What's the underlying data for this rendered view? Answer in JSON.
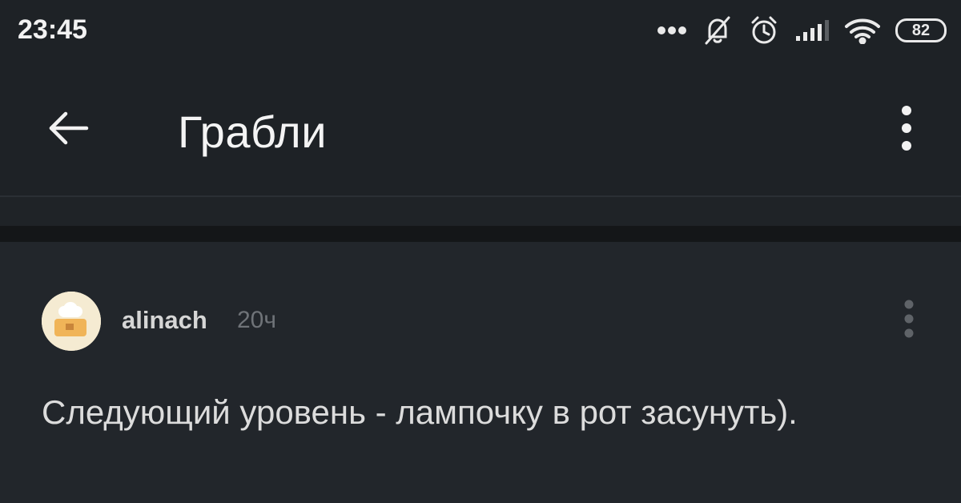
{
  "status_bar": {
    "time": "23:45",
    "icons": [
      "more-dots-icon",
      "bell-muted-icon",
      "alarm-icon",
      "signal-icon",
      "wifi-icon",
      "battery-icon"
    ],
    "battery_level": "82"
  },
  "app_bar": {
    "back_icon": "arrow-left-icon",
    "title": "Грабли",
    "menu_icon": "vertical-dots-icon"
  },
  "comment": {
    "author": "alinach",
    "time_ago": "20ч",
    "text": "Следующий уровень - лампочку в рот засунуть).",
    "menu_icon": "vertical-dots-icon"
  },
  "colors": {
    "background": "#22262b",
    "bar_background": "#1e2226",
    "divider": "#141618",
    "text_primary": "#dcdcdc",
    "text_muted": "#6f7378"
  }
}
